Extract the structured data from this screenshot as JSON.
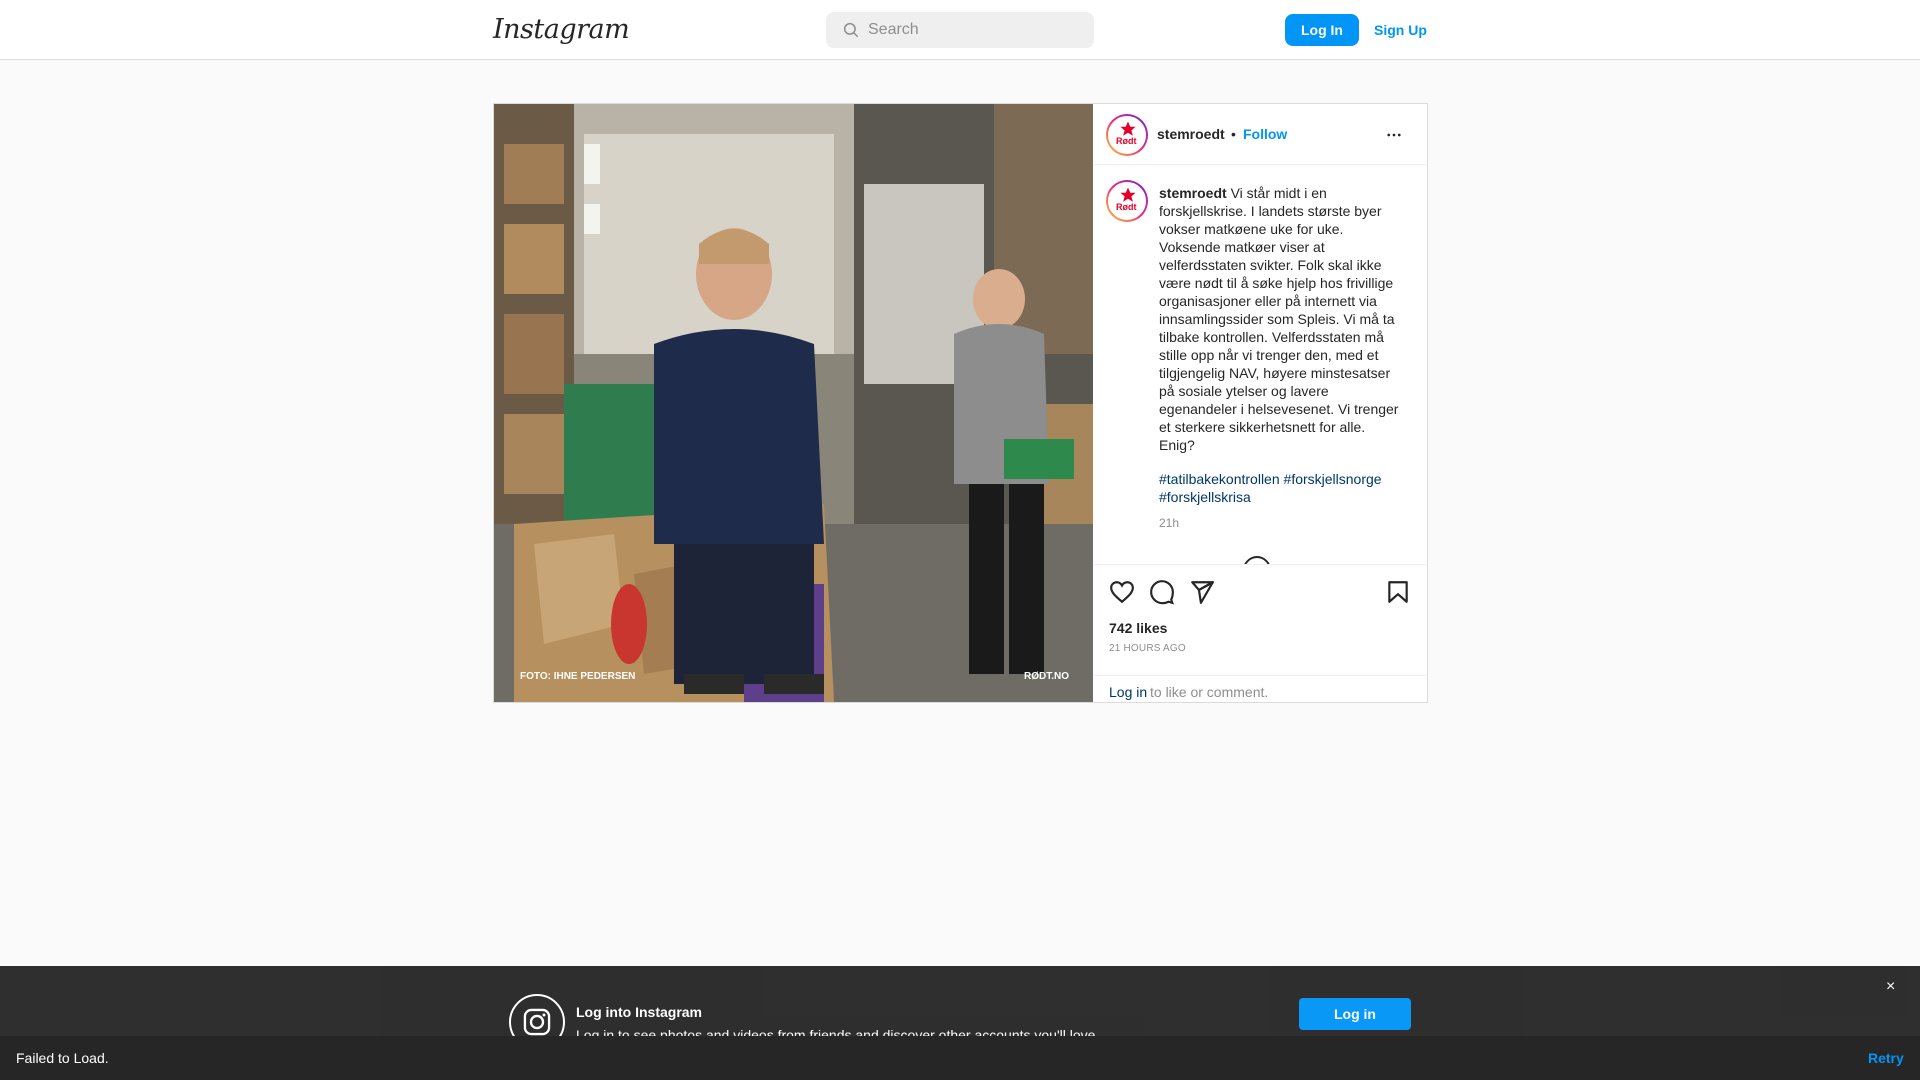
{
  "header": {
    "logo_text": "Instagram",
    "search_placeholder": "Search",
    "login_label": "Log In",
    "signup_label": "Sign Up"
  },
  "post": {
    "avatar_text": "Rødt",
    "username": "stemroedt",
    "separator": "•",
    "follow_label": "Follow",
    "caption_username": "stemroedt",
    "caption_text": "Vi står midt i en forskjellskrise. I landets største byer vokser matkøene uke for uke. Voksende matkøer viser at velferdsstaten svikter. Folk skal ikke være nødt til å søke hjelp hos frivillige organisasjoner eller på internett via innsamlingssider som Spleis. Vi må ta tilbake kontrollen. Velferdsstaten må stille opp når vi trenger den, med et tilgjengelig NAV, høyere minstesatser på sosiale ytelser og lavere egenandeler i helsevesenet. Vi trenger et sterkere sikkerhetsnett for alle. Enig?",
    "hashtags": [
      "#tatilbakekontrollen",
      "#forskjellsnorge",
      "#forskjellskrisa"
    ],
    "caption_time": "21h",
    "likes": "742 likes",
    "post_time": "21 HOURS AGO",
    "login_link": "Log in",
    "login_rest": "to like or comment.",
    "photo": {
      "credit": "FOTO: IHNE PEDERSEN",
      "brand": "RØDT.NO"
    }
  },
  "banner": {
    "title": "Log into Instagram",
    "subtitle": "Log in to see photos and videos from friends and discover other accounts you'll love.",
    "button_label": "Log in",
    "close_glyph": "×"
  },
  "toast": {
    "message": "Failed to Load.",
    "retry_label": "Retry"
  },
  "colors": {
    "accent": "#0095f6",
    "link": "#00376b",
    "muted": "#8e8e8e",
    "brand_red": "#e4002b"
  }
}
